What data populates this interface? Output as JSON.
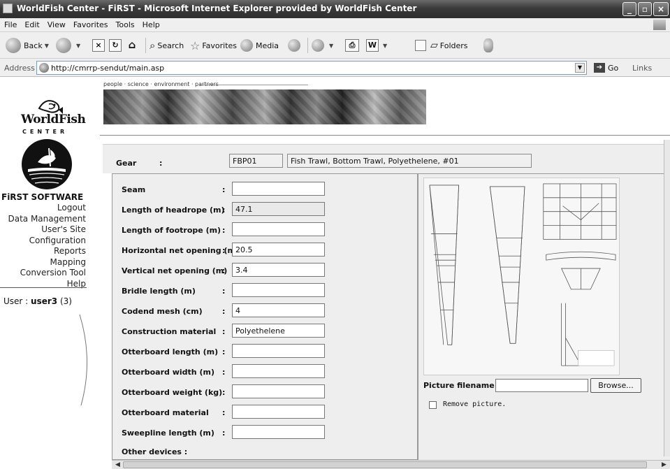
{
  "window": {
    "title": "WorldFish Center - FiRST - Microsoft Internet Explorer provided by WorldFish Center",
    "minimize": "_",
    "maximize": "▫",
    "close": "×"
  },
  "menubar": [
    "File",
    "Edit",
    "View",
    "Favorites",
    "Tools",
    "Help"
  ],
  "toolbar": {
    "back": "Back",
    "search": "Search",
    "favorites": "Favorites",
    "media": "Media",
    "folders": "Folders",
    "word_letter": "W"
  },
  "address": {
    "label": "Address",
    "url": "http://cmrrp-sendut/main.asp",
    "go": "Go",
    "links": "Links"
  },
  "header": {
    "tagline": "people · science · environment · partners"
  },
  "logo": {
    "word": "WorldFish",
    "sub": "CENTER"
  },
  "sidebar": {
    "heading": "FiRST SOFTWARE",
    "items": [
      "Logout",
      "Data Management",
      "User's Site",
      "Configuration",
      "Reports",
      "Mapping",
      "Conversion Tool",
      "Help"
    ],
    "user_label": "User :",
    "user_value": "user3",
    "user_id": "(3)"
  },
  "gear": {
    "label": "Gear",
    "colon": ":",
    "code": "FBP01",
    "description": "Fish Trawl, Bottom Trawl, Polyethelene, #01"
  },
  "fields": [
    {
      "label": "Seam",
      "value": ""
    },
    {
      "label": "Length of headrope (m)",
      "value": "47.1"
    },
    {
      "label": "Length of footrope (m)",
      "value": ""
    },
    {
      "label": "Horizontal net opening (m)",
      "value": "20.5"
    },
    {
      "label": "Vertical net opening (m)",
      "value": "3.4"
    },
    {
      "label": "Bridle length (m)",
      "value": ""
    },
    {
      "label": "Codend mesh (cm)",
      "value": "4"
    },
    {
      "label": "Construction material",
      "value": "Polyethelene"
    },
    {
      "label": "Otterboard length (m)",
      "value": ""
    },
    {
      "label": "Otterboard width (m)",
      "value": ""
    },
    {
      "label": "Otterboard weight (kg)",
      "value": ""
    },
    {
      "label": "Otterboard material",
      "value": ""
    },
    {
      "label": "Sweepline length (m)",
      "value": ""
    }
  ],
  "other_devices": "Other devices :",
  "picture": {
    "filename_label": "Picture filename :",
    "browse": "Browse...",
    "remove": "Remove picture."
  }
}
